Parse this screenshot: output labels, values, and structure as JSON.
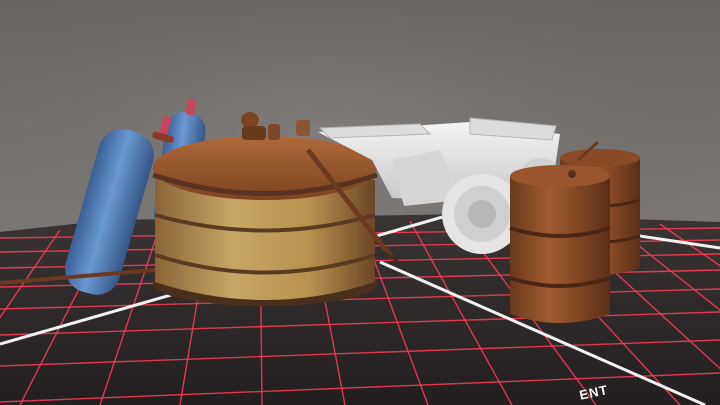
{
  "scene": {
    "floor_label": "ENT",
    "colors": {
      "backdrop": "#6f6b69",
      "floor": "#2b2626",
      "grid": "#ff3d57",
      "rust": "#8a4a25",
      "tank_blue": "#4f7fbd",
      "quad": "#e8e8e8"
    },
    "objects": [
      "gas-cylinder-left",
      "gas-cylinder-right",
      "rusty-round-tank",
      "quad-bike",
      "rusty-barrel-front",
      "rusty-barrel-back"
    ]
  }
}
